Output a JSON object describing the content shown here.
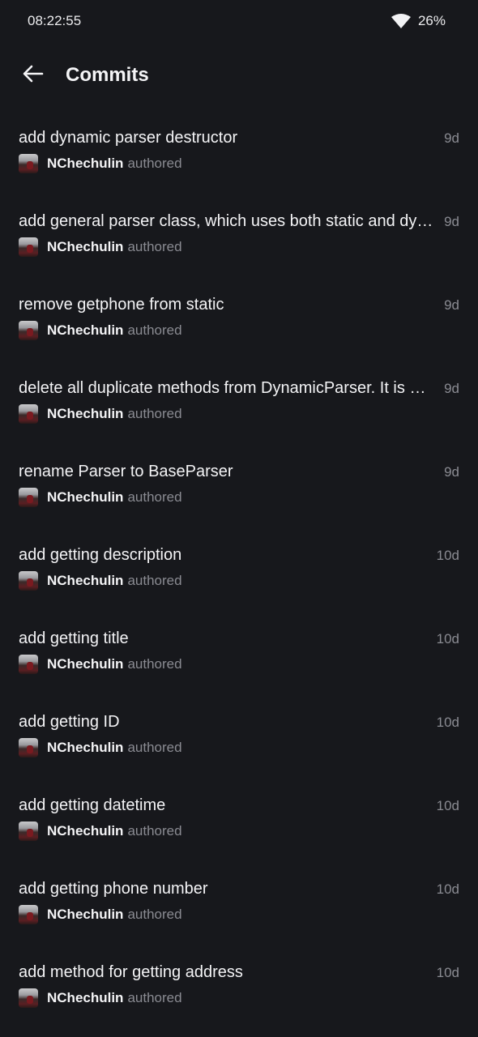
{
  "status_bar": {
    "time": "08:22:55",
    "battery": "26%",
    "wifi_icon": "wifi-icon"
  },
  "header": {
    "title": "Commits",
    "back_icon": "arrow-left-icon"
  },
  "commits": [
    {
      "message": "add dynamic parser destructor",
      "age": "9d",
      "author": "NChechulin",
      "verb": "authored"
    },
    {
      "message": "add general parser class, which uses both static and dynamic parsers",
      "age": "9d",
      "author": "NChechulin",
      "verb": "authored"
    },
    {
      "message": "remove getphone from static",
      "age": "9d",
      "author": "NChechulin",
      "verb": "authored"
    },
    {
      "message": "delete all duplicate methods from DynamicParser. It is now inherited",
      "age": "9d",
      "author": "NChechulin",
      "verb": "authored"
    },
    {
      "message": "rename Parser to BaseParser",
      "age": "9d",
      "author": "NChechulin",
      "verb": "authored"
    },
    {
      "message": "add getting description",
      "age": "10d",
      "author": "NChechulin",
      "verb": "authored"
    },
    {
      "message": "add getting title",
      "age": "10d",
      "author": "NChechulin",
      "verb": "authored"
    },
    {
      "message": "add getting ID",
      "age": "10d",
      "author": "NChechulin",
      "verb": "authored"
    },
    {
      "message": "add getting datetime",
      "age": "10d",
      "author": "NChechulin",
      "verb": "authored"
    },
    {
      "message": "add getting phone number",
      "age": "10d",
      "author": "NChechulin",
      "verb": "authored"
    },
    {
      "message": "add method for getting address",
      "age": "10d",
      "author": "NChechulin",
      "verb": "authored"
    }
  ],
  "colors": {
    "background": "#17181c",
    "primary_text": "#f4f4f6",
    "secondary_text": "#8a8b92"
  }
}
